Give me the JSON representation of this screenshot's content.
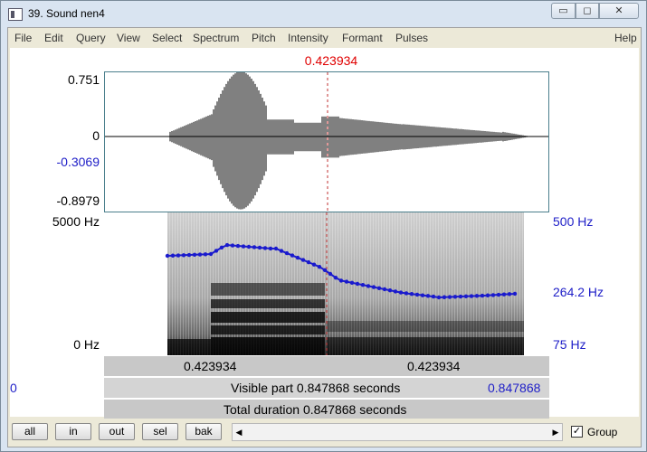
{
  "window": {
    "title": "39. Sound nen4"
  },
  "menu": [
    "File",
    "Edit",
    "Query",
    "View",
    "Select",
    "Spectrum",
    "Pitch",
    "Intensity",
    "Formant",
    "Pulses",
    "Help"
  ],
  "cursor_time": "0.423934",
  "waveform": {
    "y_labels": [
      "0.751",
      "0",
      "-0.3069",
      "-0.8979"
    ]
  },
  "spectrogram": {
    "left_labels": [
      "5000 Hz",
      "0 Hz"
    ],
    "right_labels": [
      "500 Hz",
      "264.2 Hz",
      "75 Hz"
    ]
  },
  "time_bar": {
    "left": "0.423934",
    "right": "0.423934"
  },
  "visible_bar": {
    "start": "0",
    "text": "Visible part 0.847868 seconds",
    "end": "0.847868"
  },
  "total_bar": {
    "text": "Total duration 0.847868 seconds"
  },
  "buttons": [
    "all",
    "in",
    "out",
    "sel",
    "bak"
  ],
  "group": {
    "label": "Group",
    "checked": true
  },
  "colors": {
    "cursor": "#e00000",
    "pitch": "#1a1acd",
    "blue_text": "#2020c8"
  }
}
